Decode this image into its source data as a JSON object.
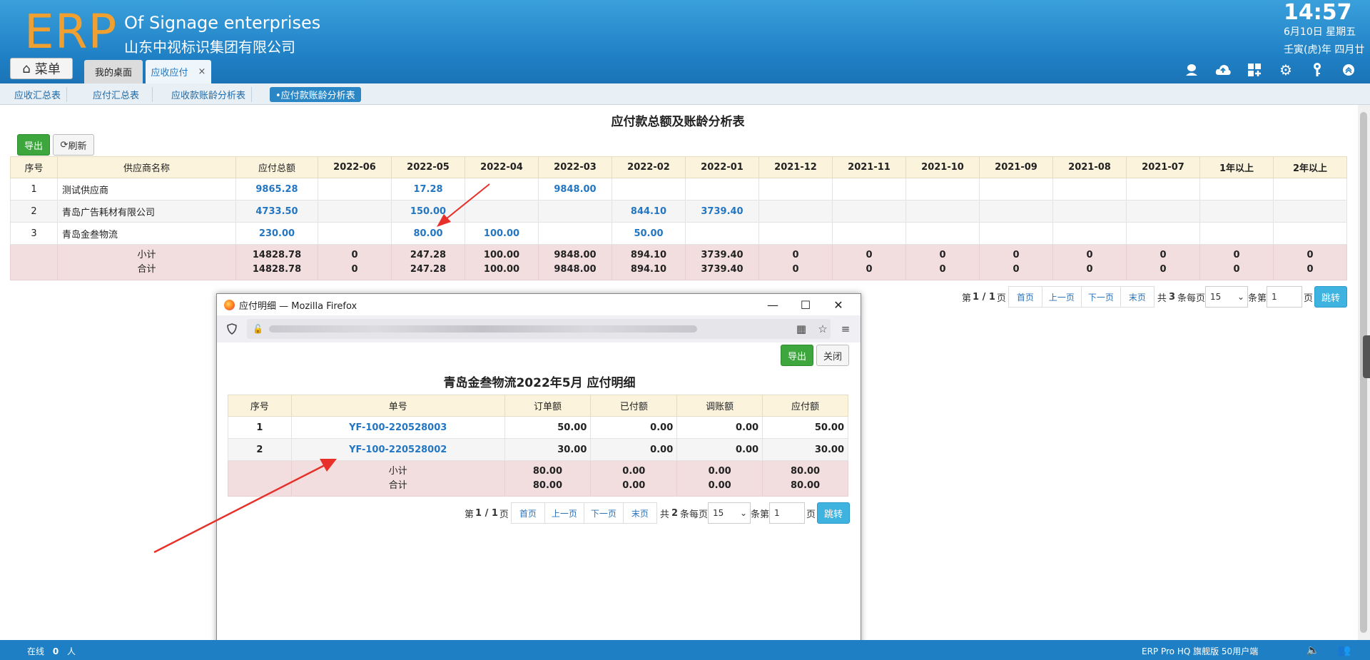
{
  "header": {
    "logo": "ERP",
    "brand_en": "Of Signage enterprises",
    "brand_cn": "山东中视标识集团有限公司",
    "clock": "14:57",
    "date": "6月10日 星期五",
    "lunar": "壬寅(虎)年 四月廿",
    "menu_label": "菜单",
    "tabs": [
      {
        "label": "我的桌面"
      },
      {
        "label": "应收应付",
        "close": "×"
      }
    ],
    "icons": [
      "user-icon",
      "cloud-icon",
      "grid-icon",
      "gear-icon",
      "key-icon",
      "collapse-icon"
    ]
  },
  "subnav": {
    "tabs": [
      "应收汇总表",
      "应付汇总表",
      "应收款账龄分析表",
      "•应付款账龄分析表"
    ]
  },
  "main": {
    "title": "应付款总额及账龄分析表",
    "export_label": "导出",
    "refresh_label": "刷新",
    "columns": [
      "序号",
      "供应商名称",
      "应付总额",
      "2022-06",
      "2022-05",
      "2022-04",
      "2022-03",
      "2022-02",
      "2022-01",
      "2021-12",
      "2021-11",
      "2021-10",
      "2021-09",
      "2021-08",
      "2021-07",
      "1年以上",
      "2年以上"
    ],
    "rows": [
      [
        "1",
        "测试供应商",
        "9865.28",
        "",
        "17.28",
        "",
        "9848.00",
        "",
        "",
        "",
        "",
        "",
        "",
        "",
        "",
        "",
        ""
      ],
      [
        "2",
        "青岛广告耗材有限公司",
        "4733.50",
        "",
        "150.00",
        "",
        "",
        "844.10",
        "3739.40",
        "",
        "",
        "",
        "",
        "",
        "",
        "",
        ""
      ],
      [
        "3",
        "青岛金叁物流",
        "230.00",
        "",
        "80.00",
        "100.00",
        "",
        "50.00",
        "",
        "",
        "",
        "",
        "",
        "",
        "",
        "",
        ""
      ]
    ],
    "subtotal_label": "小计",
    "total_label": "合计",
    "subtotal": [
      "14828.78",
      "0",
      "247.28",
      "100.00",
      "9848.00",
      "894.10",
      "3739.40",
      "0",
      "0",
      "0",
      "0",
      "0",
      "0",
      "0",
      "0"
    ],
    "total": [
      "14828.78",
      "0",
      "247.28",
      "100.00",
      "9848.00",
      "894.10",
      "3739.40",
      "0",
      "0",
      "0",
      "0",
      "0",
      "0",
      "0",
      "0"
    ],
    "pager": {
      "page_info_pre": "第",
      "page_info": "1 / 1",
      "page_info_post": "页",
      "first": "首页",
      "prev": "上一页",
      "next": "下一页",
      "last": "末页",
      "count_pre": "共",
      "count": "3",
      "count_post": "条每页",
      "per_page": "15",
      "goto_pre": "条第",
      "goto_value": "1",
      "goto_post": "页",
      "go": "跳转"
    }
  },
  "popup": {
    "window_title": "应付明细 — Mozilla Firefox",
    "export_label": "导出",
    "close_label": "关闭",
    "title": "青岛金叁物流2022年5月 应付明细",
    "columns": [
      "序号",
      "单号",
      "订单额",
      "已付额",
      "调账额",
      "应付额"
    ],
    "rows": [
      [
        "1",
        "YF-100-220528003",
        "50.00",
        "0.00",
        "0.00",
        "50.00"
      ],
      [
        "2",
        "YF-100-220528002",
        "30.00",
        "0.00",
        "0.00",
        "30.00"
      ]
    ],
    "subtotal_label": "小计",
    "total_label": "合计",
    "subtotal": [
      "80.00",
      "0.00",
      "0.00",
      "80.00"
    ],
    "total": [
      "80.00",
      "0.00",
      "0.00",
      "80.00"
    ],
    "pager": {
      "page_info_pre": "第",
      "page_info": "1 / 1",
      "page_info_post": "页",
      "first": "首页",
      "prev": "上一页",
      "next": "下一页",
      "last": "末页",
      "count_pre": "共",
      "count": "2",
      "count_post": "条每页",
      "per_page": "15",
      "goto_pre": "条第",
      "goto_value": "1",
      "goto_post": "页",
      "go": "跳转"
    }
  },
  "footer": {
    "online_label": "在线",
    "online_count": "0",
    "online_unit": "人",
    "version": "ERP Pro HQ 旗舰版 50用户端"
  },
  "colors": {
    "header_blue": "#1f7fc4",
    "logo_orange": "#f0a030",
    "link_blue": "#2376c2",
    "export_green": "#3da73d",
    "total_row_pink": "#f2dedf",
    "table_head_yellow": "#fbf3dc",
    "annotation_red": "#e8302a"
  }
}
